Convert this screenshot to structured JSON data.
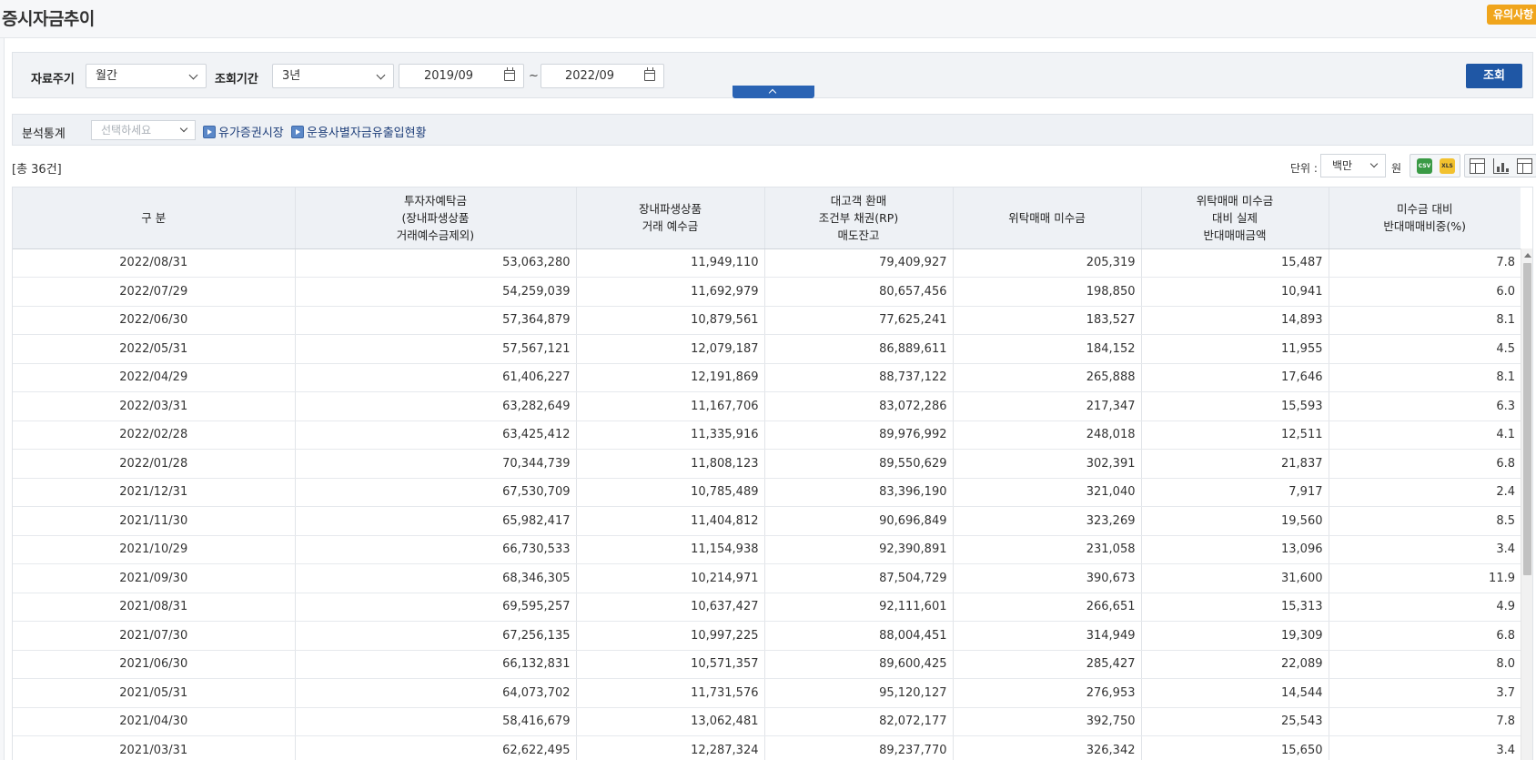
{
  "page": {
    "title": "증시자금추이",
    "notice_label": "유의사항"
  },
  "search": {
    "period_label": "자료주기",
    "period_value": "월간",
    "range_label": "조회기간",
    "range_value": "3년",
    "start_date": "2019/09",
    "range_separator": "~",
    "end_date": "2022/09",
    "submit_label": "조회"
  },
  "analysis": {
    "label": "분석통계",
    "select_placeholder": "선택하세요",
    "links": [
      "유가증권시장",
      "운용사별자금유출입현황"
    ]
  },
  "summary": {
    "total": "[총 36건]",
    "unit_label": "단위 :",
    "unit_value": "백만",
    "unit_suffix": "원"
  },
  "toolbar_icons": [
    "csv-download-icon",
    "excel-download-icon",
    "grid-view-icon",
    "chart-view-icon",
    "table-view-icon"
  ],
  "table": {
    "headers": [
      "구 분",
      "투자자예탁금\n(장내파생상품\n거래예수금제외)",
      "장내파생상품\n거래 예수금",
      "대고객 환매\n조건부 채권(RP)\n매도잔고",
      "위탁매매 미수금",
      "위탁매매 미수금\n대비 실제\n반대매매금액",
      "미수금 대비\n반대매매비중(%)"
    ],
    "rows": [
      [
        "2022/08/31",
        "53,063,280",
        "11,949,110",
        "79,409,927",
        "205,319",
        "15,487",
        "7.8"
      ],
      [
        "2022/07/29",
        "54,259,039",
        "11,692,979",
        "80,657,456",
        "198,850",
        "10,941",
        "6.0"
      ],
      [
        "2022/06/30",
        "57,364,879",
        "10,879,561",
        "77,625,241",
        "183,527",
        "14,893",
        "8.1"
      ],
      [
        "2022/05/31",
        "57,567,121",
        "12,079,187",
        "86,889,611",
        "184,152",
        "11,955",
        "4.5"
      ],
      [
        "2022/04/29",
        "61,406,227",
        "12,191,869",
        "88,737,122",
        "265,888",
        "17,646",
        "8.1"
      ],
      [
        "2022/03/31",
        "63,282,649",
        "11,167,706",
        "83,072,286",
        "217,347",
        "15,593",
        "6.3"
      ],
      [
        "2022/02/28",
        "63,425,412",
        "11,335,916",
        "89,976,992",
        "248,018",
        "12,511",
        "4.1"
      ],
      [
        "2022/01/28",
        "70,344,739",
        "11,808,123",
        "89,550,629",
        "302,391",
        "21,837",
        "6.8"
      ],
      [
        "2021/12/31",
        "67,530,709",
        "10,785,489",
        "83,396,190",
        "321,040",
        "7,917",
        "2.4"
      ],
      [
        "2021/11/30",
        "65,982,417",
        "11,404,812",
        "90,696,849",
        "323,269",
        "19,560",
        "8.5"
      ],
      [
        "2021/10/29",
        "66,730,533",
        "11,154,938",
        "92,390,891",
        "231,058",
        "13,096",
        "3.4"
      ],
      [
        "2021/09/30",
        "68,346,305",
        "10,214,971",
        "87,504,729",
        "390,673",
        "31,600",
        "11.9"
      ],
      [
        "2021/08/31",
        "69,595,257",
        "10,637,427",
        "92,111,601",
        "266,651",
        "15,313",
        "4.9"
      ],
      [
        "2021/07/30",
        "67,256,135",
        "10,997,225",
        "88,004,451",
        "314,949",
        "19,309",
        "6.8"
      ],
      [
        "2021/06/30",
        "66,132,831",
        "10,571,357",
        "89,600,425",
        "285,427",
        "22,089",
        "8.0"
      ],
      [
        "2021/05/31",
        "64,073,702",
        "11,731,576",
        "95,120,127",
        "276,953",
        "14,544",
        "3.7"
      ],
      [
        "2021/04/30",
        "58,416,679",
        "13,062,481",
        "82,072,177",
        "392,750",
        "25,543",
        "7.8"
      ],
      [
        "2021/03/31",
        "62,622,495",
        "12,287,324",
        "89,237,770",
        "326,342",
        "15,650",
        "3.4"
      ]
    ]
  }
}
